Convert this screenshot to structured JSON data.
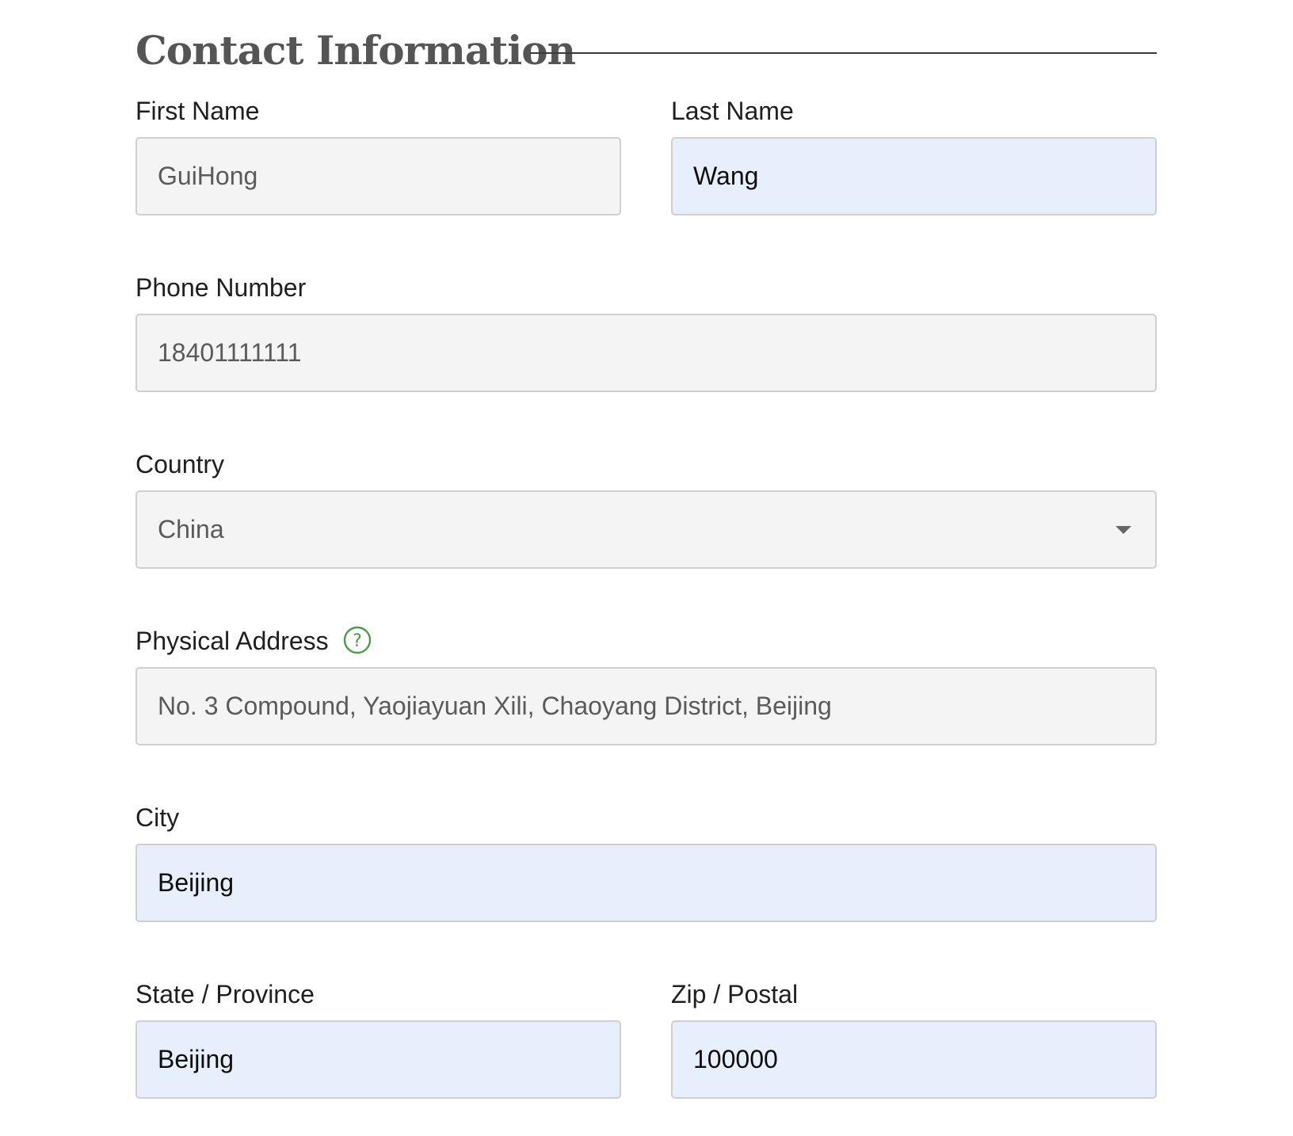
{
  "section": {
    "title": "Contact Information"
  },
  "fields": {
    "first_name": {
      "label": "First Name",
      "value": "GuiHong"
    },
    "last_name": {
      "label": "Last Name",
      "value": "Wang"
    },
    "phone": {
      "label": "Phone Number",
      "value": "18401111111"
    },
    "country": {
      "label": "Country",
      "value": "China"
    },
    "address": {
      "label": "Physical Address",
      "value": "No. 3 Compound, Yaojiayuan Xili, Chaoyang District, Beijing",
      "help_icon": "question-circle-icon"
    },
    "city": {
      "label": "City",
      "value": "Beijing"
    },
    "state": {
      "label": "State / Province",
      "value": "Beijing"
    },
    "zip": {
      "label": "Zip / Postal",
      "value": "100000"
    }
  },
  "colors": {
    "readonly_background": "#f4f4f4",
    "editable_background": "#e8effc",
    "help_icon": "#4a9a4a",
    "title": "#555555"
  }
}
